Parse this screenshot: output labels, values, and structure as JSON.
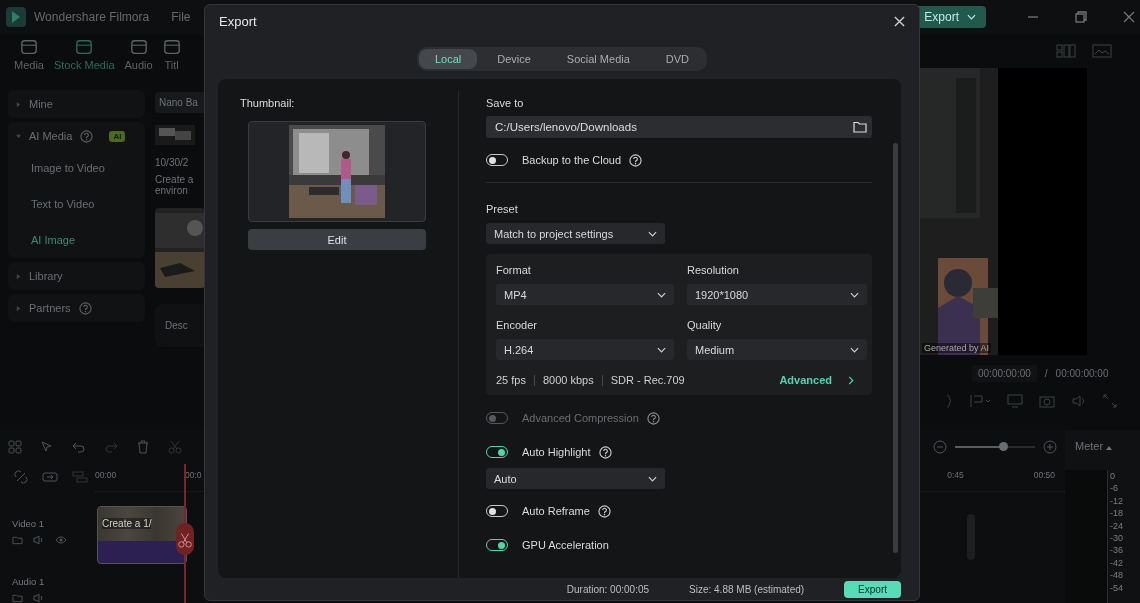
{
  "titlebar": {
    "app_name": "Wondershare Filmora",
    "menu": [
      "File"
    ],
    "export_button": "Export"
  },
  "media_tabs": [
    {
      "label": "Media",
      "selected": false
    },
    {
      "label": "Stock Media",
      "selected": true
    },
    {
      "label": "Audio",
      "selected": false
    },
    {
      "label": "Titl",
      "selected": false
    }
  ],
  "sidebar": {
    "items": [
      {
        "label": "Mine",
        "expanded": false,
        "help": false
      },
      {
        "label": "AI Media",
        "expanded": true,
        "help": true,
        "badge": "AI",
        "children": [
          {
            "label": "Image to Video",
            "selected": false
          },
          {
            "label": "Text to Video",
            "selected": false
          },
          {
            "label": "AI Image",
            "selected": true
          }
        ]
      },
      {
        "label": "Library",
        "expanded": false,
        "help": false
      },
      {
        "label": "Partners",
        "expanded": false,
        "help": true
      }
    ]
  },
  "browser": {
    "search": "Nano Ba",
    "date": "10/30/2",
    "description": [
      "Create a",
      "environ"
    ],
    "prompt_placeholder": "Desc"
  },
  "preview": {
    "caption": "Generated by AI",
    "current_time": "00:00:00:00",
    "separator": "/",
    "total_time": "00:00:00:00"
  },
  "timeline": {
    "ruler_left": [
      "00:00",
      "00:0"
    ],
    "ruler_right": [
      "0:45",
      "00:50"
    ],
    "tracks": [
      {
        "name": "Video 1",
        "kind": "video"
      },
      {
        "name": "Audio 1",
        "kind": "audio"
      }
    ],
    "clip": "Create a 1/",
    "zoom": {
      "level": 0.6
    },
    "meter": {
      "label": "Meter",
      "scale": [
        "0",
        "-6",
        "-12",
        "-18",
        "-24",
        "-30",
        "-36",
        "-42",
        "-48",
        "-54"
      ]
    }
  },
  "dialog": {
    "title": "Export",
    "tabs": [
      {
        "label": "Local",
        "selected": true
      },
      {
        "label": "Device",
        "selected": false
      },
      {
        "label": "Social Media",
        "selected": false
      },
      {
        "label": "DVD",
        "selected": false
      }
    ],
    "thumbnail": {
      "label": "Thumbnail:",
      "edit_button": "Edit"
    },
    "save_to": {
      "label": "Save to",
      "path": "C:/Users/lenovo/Downloads"
    },
    "backup": {
      "label": "Backup to the Cloud",
      "on": false,
      "disabled": false,
      "help": true
    },
    "preset": {
      "label": "Preset",
      "value": "Match to project settings"
    },
    "settings": {
      "fields": [
        {
          "label": "Format",
          "value": "MP4"
        },
        {
          "label": "Resolution",
          "value": "1920*1080"
        },
        {
          "label": "Encoder",
          "value": "H.264"
        },
        {
          "label": "Quality",
          "value": "Medium"
        }
      ],
      "summary": [
        "25 fps",
        "8000 kbps",
        "SDR - Rec.709"
      ],
      "advanced": "Advanced"
    },
    "options": [
      {
        "kind": "toggle",
        "label": "Advanced Compression",
        "on": false,
        "disabled": true,
        "help": true
      },
      {
        "kind": "toggle",
        "label": "Auto Highlight",
        "on": true,
        "disabled": false,
        "help": true
      },
      {
        "kind": "dropdown",
        "value": "Auto"
      },
      {
        "kind": "toggle",
        "label": "Auto Reframe",
        "on": false,
        "disabled": false,
        "help": true
      },
      {
        "kind": "toggle",
        "label": "GPU Acceleration",
        "on": true,
        "disabled": false,
        "help": false
      }
    ],
    "footer": {
      "duration": "Duration: 00:00:05",
      "size": "Size: 4.88 MB (estimated)",
      "export_button": "Export"
    }
  }
}
